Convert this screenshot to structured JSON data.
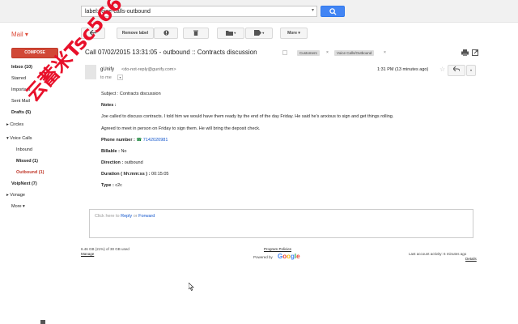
{
  "search": {
    "query": "label:voice-calls-outbound"
  },
  "header": {
    "app_label": "Mail ▾",
    "compose_label": "COMPOSE"
  },
  "toolbar": {
    "remove_label": "Remove label",
    "more_label": "More ▾"
  },
  "sidebar": {
    "items": [
      {
        "label": "Inbox (10)",
        "style": "bold"
      },
      {
        "label": "Starred",
        "style": ""
      },
      {
        "label": "Important",
        "style": ""
      },
      {
        "label": "Sent Mail",
        "style": ""
      },
      {
        "label": "Drafts (5)",
        "style": "bold"
      },
      {
        "label": "▸ Circles",
        "style": ""
      },
      {
        "label": "▾ Voice Calls",
        "style": ""
      },
      {
        "label": "Inbound",
        "style": "sub"
      },
      {
        "label": "Missed (1)",
        "style": "bold sub"
      },
      {
        "label": "Outbound (1)",
        "style": "red sub"
      },
      {
        "label": "VoipNext (7)",
        "style": "bold"
      },
      {
        "label": "▸ Vonage",
        "style": ""
      },
      {
        "label": "More ▾",
        "style": ""
      }
    ]
  },
  "watermark": {
    "text": "云蓄米Tsc566"
  },
  "message": {
    "subject": "Call 07/02/2015 13:31:05 - outbound :: Contracts discussion",
    "labels": [
      "Customers",
      "Voice Calls/Outbound"
    ],
    "sender_name": "gUnify",
    "sender_email": "<do-not-reply@gunify.com>",
    "to": "to me",
    "time": "1:31 PM (13 minutes ago)",
    "body": {
      "subject_line": "Subject : Contracts discussion",
      "notes_label": "Notes :",
      "notes_text": "Joe called to discuss contracts. I told him we would have them ready by the end of the day Friday. He said he's anxious to sign and get things rolling.",
      "notes_text2": "Agreed to meet in person on Friday to sign them. He will bring the deposit check.",
      "phone_label": "Phone number :",
      "phone_value": "7142020981",
      "billable_label": "Billable :",
      "billable_value": "No",
      "direction_label": "Direction :",
      "direction_value": "outbound",
      "duration_label": "Duration ( hh:mm:ss ) :",
      "duration_value": "00:15:05",
      "type_label": "Type :",
      "type_value": "c2c"
    }
  },
  "reply": {
    "prefix": "Click here to ",
    "reply_link": "Reply",
    "or": " or ",
    "forward_link": "Forward"
  },
  "footer": {
    "storage": "6.46 GB (21%) of 30 GB used",
    "manage": "Manage",
    "policies": "Program Policies",
    "powered_by": "Powered by",
    "google": "Google",
    "last_activity": "Last account activity: 6 minutes ago",
    "details": "Details"
  }
}
